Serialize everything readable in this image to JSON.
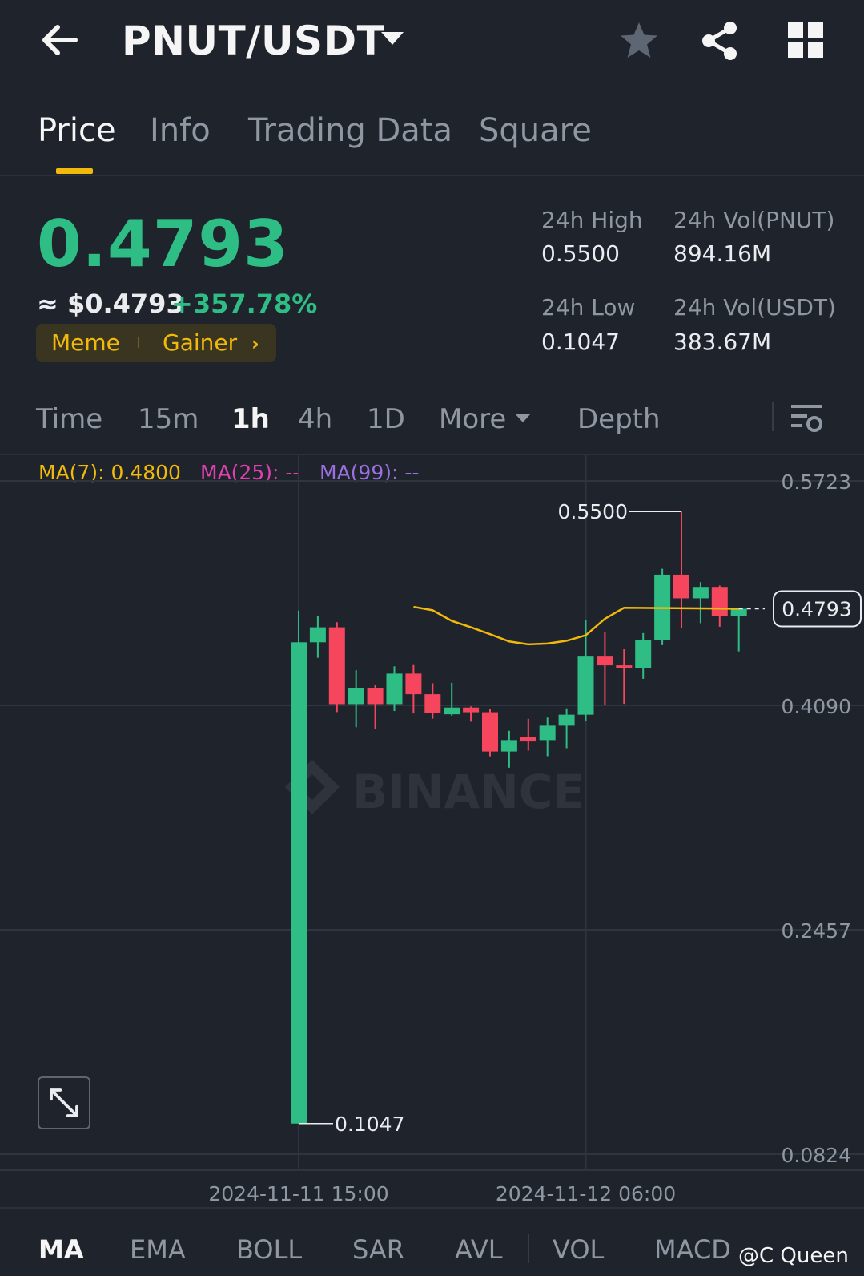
{
  "header": {
    "pair": "PNUT/USDT",
    "icons": [
      "back-arrow-icon",
      "caret-down-icon",
      "star-icon",
      "share-icon",
      "grid-icon"
    ]
  },
  "tabs": [
    {
      "label": "Price",
      "active": true
    },
    {
      "label": "Info",
      "active": false
    },
    {
      "label": "Trading Data",
      "active": false
    },
    {
      "label": "Square",
      "active": false
    }
  ],
  "price": {
    "last": "0.4793",
    "fiat": "≈ $0.4793",
    "change": "+357.78%",
    "tags": [
      "Meme",
      "Gainer"
    ]
  },
  "stats": {
    "high_label": "24h High",
    "high": "0.5500",
    "low_label": "24h Low",
    "low": "0.1047",
    "vol_base_label": "24h Vol(PNUT)",
    "vol_base": "894.16M",
    "vol_quote_label": "24h Vol(USDT)",
    "vol_quote": "383.67M"
  },
  "intervals": [
    {
      "label": "Time",
      "active": false
    },
    {
      "label": "15m",
      "active": false
    },
    {
      "label": "1h",
      "active": true
    },
    {
      "label": "4h",
      "active": false
    },
    {
      "label": "1D",
      "active": false
    },
    {
      "label": "More",
      "active": false
    },
    {
      "label": "Depth",
      "active": false
    }
  ],
  "ma_legend": {
    "ma7": "MA(7): 0.4800",
    "ma25": "MA(25): --",
    "ma99": "MA(99): --"
  },
  "indicators": [
    {
      "label": "MA",
      "active": true
    },
    {
      "label": "EMA",
      "active": false
    },
    {
      "label": "BOLL",
      "active": false
    },
    {
      "label": "SAR",
      "active": false
    },
    {
      "label": "AVL",
      "active": false
    },
    {
      "label": "VOL",
      "active": false
    },
    {
      "label": "MACD",
      "active": false
    }
  ],
  "watermark": {
    "chart": "BINANCE",
    "author": "@C Queen"
  },
  "colors": {
    "up": "#2ebd85",
    "down": "#f6465d",
    "accent": "#f0b90b",
    "ma25": "#e040b0",
    "ma99": "#9b6fe0"
  },
  "chart_data": {
    "type": "candlestick",
    "interval": "1h",
    "y_ticks": [
      0.5723,
      0.409,
      0.2457,
      0.0824
    ],
    "ylim": [
      0.0824,
      0.5723
    ],
    "x_ticks": [
      "2024-11-11 15:00",
      "2024-11-12 06:00"
    ],
    "high_marker": "0.5500",
    "low_marker": "0.1047",
    "last_price_label": "0.4793",
    "candles": [
      {
        "o": 0.1047,
        "h": 0.478,
        "l": 0.1047,
        "c": 0.4549
      },
      {
        "o": 0.4549,
        "h": 0.474,
        "l": 0.4436,
        "c": 0.4658
      },
      {
        "o": 0.4658,
        "h": 0.4695,
        "l": 0.4041,
        "c": 0.4099
      },
      {
        "o": 0.4099,
        "h": 0.4345,
        "l": 0.3931,
        "c": 0.4217
      },
      {
        "o": 0.4217,
        "h": 0.4236,
        "l": 0.3915,
        "c": 0.4099
      },
      {
        "o": 0.4099,
        "h": 0.4374,
        "l": 0.4049,
        "c": 0.4321
      },
      {
        "o": 0.4321,
        "h": 0.4383,
        "l": 0.4031,
        "c": 0.4171
      },
      {
        "o": 0.4171,
        "h": 0.4251,
        "l": 0.3993,
        "c": 0.4034
      },
      {
        "o": 0.4025,
        "h": 0.4254,
        "l": 0.4015,
        "c": 0.4074
      },
      {
        "o": 0.4074,
        "h": 0.4082,
        "l": 0.3971,
        "c": 0.404
      },
      {
        "o": 0.404,
        "h": 0.4064,
        "l": 0.3719,
        "c": 0.3754
      },
      {
        "o": 0.3754,
        "h": 0.3905,
        "l": 0.3636,
        "c": 0.3837
      },
      {
        "o": 0.3861,
        "h": 0.3992,
        "l": 0.376,
        "c": 0.3827
      },
      {
        "o": 0.3837,
        "h": 0.4001,
        "l": 0.372,
        "c": 0.3942
      },
      {
        "o": 0.3942,
        "h": 0.4068,
        "l": 0.3778,
        "c": 0.4022
      },
      {
        "o": 0.4022,
        "h": 0.4712,
        "l": 0.3979,
        "c": 0.4445
      },
      {
        "o": 0.4445,
        "h": 0.4624,
        "l": 0.4091,
        "c": 0.4381
      },
      {
        "o": 0.4381,
        "h": 0.4498,
        "l": 0.4101,
        "c": 0.4363
      },
      {
        "o": 0.4363,
        "h": 0.4616,
        "l": 0.4283,
        "c": 0.4566
      },
      {
        "o": 0.4566,
        "h": 0.5084,
        "l": 0.4528,
        "c": 0.5041
      },
      {
        "o": 0.5041,
        "h": 0.55,
        "l": 0.4649,
        "c": 0.4869
      },
      {
        "o": 0.4869,
        "h": 0.4987,
        "l": 0.4688,
        "c": 0.4952
      },
      {
        "o": 0.4952,
        "h": 0.4962,
        "l": 0.4662,
        "c": 0.4741
      },
      {
        "o": 0.4741,
        "h": 0.4799,
        "l": 0.4483,
        "c": 0.4793
      }
    ],
    "ma7": [
      null,
      null,
      null,
      null,
      null,
      null,
      0.4807,
      0.4782,
      0.4705,
      0.4658,
      0.4608,
      0.4555,
      0.4534,
      0.454,
      0.456,
      0.46,
      0.472,
      0.48
    ]
  }
}
